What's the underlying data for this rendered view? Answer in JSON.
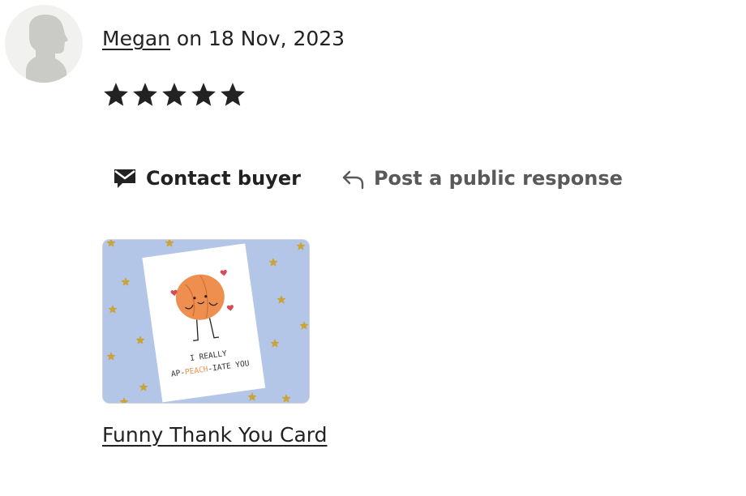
{
  "review": {
    "reviewer_name": "Megan",
    "date_text": " on 18 Nov, 2023",
    "rating": 5,
    "rating_max": 5
  },
  "actions": {
    "contact_label": "Contact buyer",
    "contact_icon": "envelope-icon",
    "response_label": "Post a public response",
    "response_icon": "reply-arrow-icon"
  },
  "listing": {
    "title": "Funny Thank You Card",
    "image_text_line1": "I REALLY",
    "image_text_line2_a": "AP-",
    "image_text_line2_b": "PEACH",
    "image_text_line2_c": "-IATE YOU"
  },
  "colors": {
    "text": "#222222",
    "muted": "#595959",
    "thumb_bg": "#b4c6e8",
    "peach": "#ee8f4f",
    "star_gold": "#caa335"
  }
}
